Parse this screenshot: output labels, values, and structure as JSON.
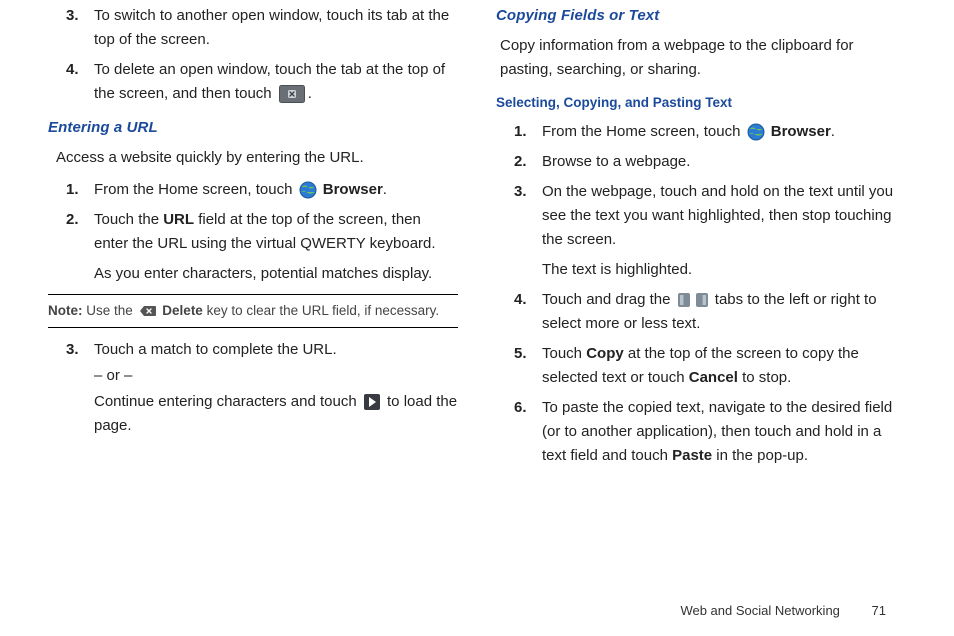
{
  "left": {
    "pre_items": [
      {
        "n": "3.",
        "body": "To switch to another open window, touch its tab at the top of the screen."
      },
      {
        "n": "4.",
        "body_a": "To delete an open window, touch the tab at the top of the screen, and then touch ",
        "body_b": "."
      }
    ],
    "h_enter": "Entering a URL",
    "enter_lede": "Access a website quickly by entering the URL.",
    "enter_steps_a": [
      {
        "n": "1.",
        "body_a": "From the Home screen, touch ",
        "browser": "Browser",
        "body_b": "."
      },
      {
        "n": "2.",
        "body_a": "Touch the ",
        "url": "URL",
        "body_b": " field at the top of the screen, then enter the URL using the virtual QWERTY keyboard.",
        "tail": "As you enter characters, potential matches display."
      }
    ],
    "note_a": "Note:",
    "note_b": " Use the ",
    "note_delete": "Delete",
    "note_c": " key to clear the URL field, if necessary.",
    "enter_steps_b": [
      {
        "n": "3.",
        "body": "Touch a match to complete the URL.",
        "or": "– or –",
        "cont_a": "Continue entering characters and touch ",
        "cont_b": " to load the page."
      }
    ]
  },
  "right": {
    "h_copy": "Copying Fields or Text",
    "copy_lede": "Copy information from a webpage to the clipboard for pasting, searching, or sharing.",
    "h_select": "Selecting, Copying, and Pasting Text",
    "steps": [
      {
        "n": "1.",
        "body_a": "From the Home screen, touch ",
        "browser": "Browser",
        "body_b": "."
      },
      {
        "n": "2.",
        "body": "Browse to a webpage."
      },
      {
        "n": "3.",
        "body": "On the webpage, touch and hold on the text until you see the text you want highlighted, then stop touching the screen.",
        "tail": "The text is highlighted."
      },
      {
        "n": "4.",
        "body_a": "Touch and drag the ",
        "body_b": " tabs to the left or right to select more or less text."
      },
      {
        "n": "5.",
        "body_a": "Touch ",
        "copy": "Copy",
        "body_b": " at the top of the screen to copy the selected text or touch ",
        "cancel": "Cancel",
        "body_c": " to stop."
      },
      {
        "n": "6.",
        "body_a": "To paste the copied text, navigate to the desired field (or to another application), then touch and hold in a text field and touch ",
        "paste": "Paste",
        "body_b": " in the pop-up."
      }
    ]
  },
  "footer": {
    "section": "Web and Social Networking",
    "page": "71"
  }
}
